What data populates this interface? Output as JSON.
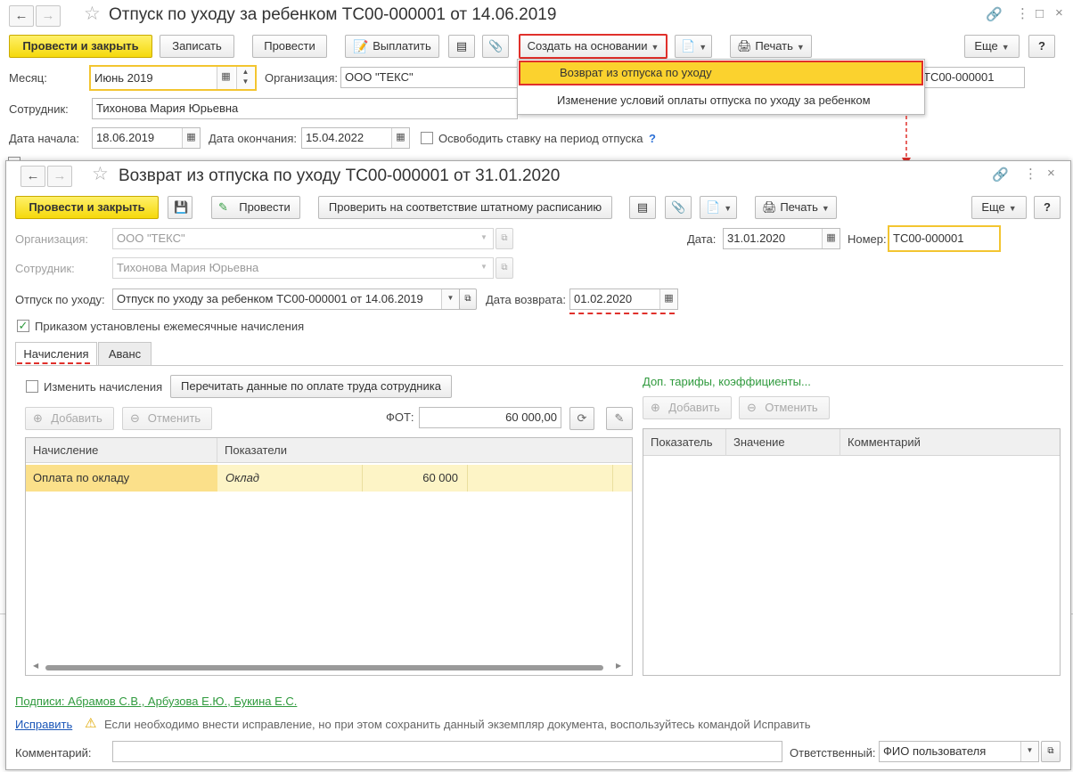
{
  "back_window": {
    "title": "Отпуск по уходу за ребенком ТС00-000001 от 14.06.2019",
    "toolbar": {
      "post_close": "Провести и закрыть",
      "write": "Записать",
      "post": "Провести",
      "pay": "Выплатить",
      "create_basis": "Создать на основании",
      "print": "Печать",
      "more": "Еще",
      "help": "?"
    },
    "month_label": "Месяц:",
    "month_value": "Июнь 2019",
    "org_label": "Организация:",
    "org_value": "ООО \"ТЕКС\"",
    "number_value": "ТС00-000001",
    "employee_label": "Сотрудник:",
    "employee_value": "Тихонова Мария Юрьевна",
    "start_label": "Дата начала:",
    "start_value": "18.06.2019",
    "end_label": "Дата окончания:",
    "end_value": "15.04.2022",
    "free_rate_label": "Освободить ставку на период отпуска",
    "free_rate_help": "?"
  },
  "dropdown_menu": {
    "items": [
      "Возврат из отпуска по уходу",
      "Изменение условий оплаты отпуска по уходу за ребенком"
    ]
  },
  "front_window": {
    "title": "Возврат из отпуска по уходу ТС00-000001 от 31.01.2020",
    "toolbar": {
      "post_close": "Провести и закрыть",
      "post": "Провести",
      "check_staff": "Проверить на соответствие штатному расписанию",
      "print": "Печать",
      "more": "Еще",
      "help": "?"
    },
    "org_label": "Организация:",
    "org_value": "ООО \"ТЕКС\"",
    "date_label": "Дата:",
    "date_value": "31.01.2020",
    "number_label": "Номер:",
    "number_value": "ТС00-000001",
    "employee_label": "Сотрудник:",
    "employee_value": "Тихонова Мария Юрьевна",
    "leave_label": "Отпуск по уходу:",
    "leave_value": "Отпуск по уходу за ребенком ТС00-000001 от 14.06.2019",
    "return_label": "Дата возврата:",
    "return_value": "01.02.2020",
    "order_label": "Приказом установлены ежемесячные начисления",
    "tabs": [
      "Начисления",
      "Аванс"
    ],
    "change_accruals_label": "Изменить начисления",
    "reread_button": "Перечитать данные по оплате труда сотрудника",
    "add_button": "Добавить",
    "cancel_button": "Отменить",
    "fot_label": "ФОТ:",
    "fot_value": "60 000,00",
    "extra_link": "Доп. тарифы, коэффициенты...",
    "left_grid": {
      "headers": [
        "Начисление",
        "Показатели"
      ],
      "rows": [
        [
          "Оплата по окладу",
          "Оклад",
          "60 000"
        ]
      ]
    },
    "right_grid": {
      "headers": [
        "Показатель",
        "Значение",
        "Комментарий"
      ]
    },
    "signatures": "Подписи: Абрамов С.В., Арбузова Е.Ю., Букина Е.С.",
    "fix_link": "Исправить",
    "fix_message": "Если необходимо внести исправление, но при этом сохранить данный экземпляр документа, воспользуйтесь командой Исправить",
    "comment_label": "Комментарий:",
    "responsible_label": "Ответственный:",
    "responsible_value": "ФИО пользователя"
  },
  "colors": {
    "main_button": "#f5d90b",
    "highlight_red": "#e0302b",
    "selected_row": "#fbe08a",
    "green_link": "#2f9a3d"
  }
}
